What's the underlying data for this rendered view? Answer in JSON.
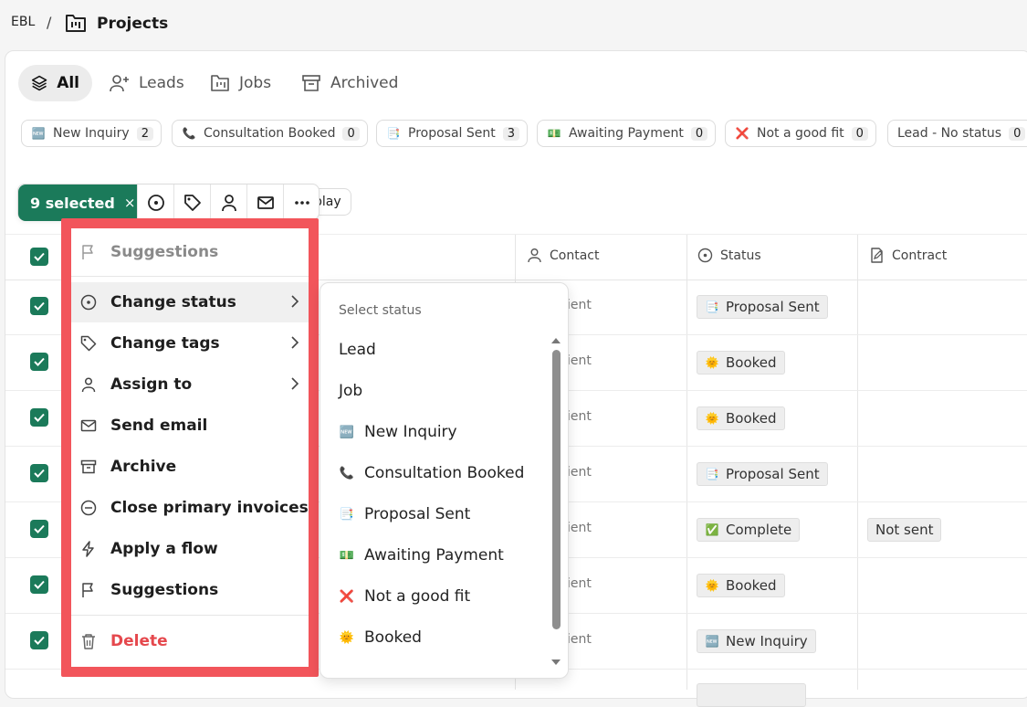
{
  "breadcrumb": {
    "root": "EBL",
    "separator": "/",
    "title": "Projects"
  },
  "tabs": [
    {
      "label": "All",
      "icon": "layers-icon",
      "active": true
    },
    {
      "label": "Leads",
      "icon": "add-user-icon"
    },
    {
      "label": "Jobs",
      "icon": "kanban-icon"
    },
    {
      "label": "Archived",
      "icon": "archive-icon"
    }
  ],
  "chips": [
    {
      "label": "New Inquiry",
      "count": "2",
      "emoji": "🆕"
    },
    {
      "label": "Consultation Booked",
      "count": "0",
      "emoji": "📞"
    },
    {
      "label": "Proposal Sent",
      "count": "3",
      "emoji": "📑"
    },
    {
      "label": "Awaiting Payment",
      "count": "0",
      "emoji": "💵"
    },
    {
      "label": "Not a good fit",
      "count": "0",
      "emoji": "❌"
    },
    {
      "label": "Lead - No status",
      "count": "0",
      "emoji": ""
    }
  ],
  "selection": {
    "label": "9 selected",
    "close": "×",
    "display_partial": "play"
  },
  "columns": {
    "contact": "Contact",
    "status": "Status",
    "contract": "Contract"
  },
  "rows": [
    {
      "contact": "ient",
      "status": "Proposal Sent",
      "status_emoji": "📑",
      "contract": ""
    },
    {
      "contact": "ient",
      "status": "Booked",
      "status_emoji": "🌞",
      "contract": ""
    },
    {
      "contact": "ient",
      "status": "Booked",
      "status_emoji": "🌞",
      "contract": ""
    },
    {
      "contact": "ient",
      "status": "Proposal Sent",
      "status_emoji": "📑",
      "contract": ""
    },
    {
      "contact": "ient",
      "status": "Complete",
      "status_emoji": "✅",
      "contract": "Not sent"
    },
    {
      "contact": "ient",
      "status": "Booked",
      "status_emoji": "🌞",
      "contract": ""
    },
    {
      "contact": "ient",
      "status": "New Inquiry",
      "status_emoji": "🆕",
      "contract": ""
    }
  ],
  "menu": {
    "suggestions_header": "Suggestions",
    "change_status": "Change status",
    "change_tags": "Change tags",
    "assign_to": "Assign to",
    "send_email": "Send email",
    "archive": "Archive",
    "close_invoices": "Close primary invoices",
    "apply_flow": "Apply a flow",
    "suggestions": "Suggestions",
    "delete": "Delete"
  },
  "status_submenu": {
    "heading": "Select status",
    "options": [
      {
        "label": "Lead",
        "emoji": ""
      },
      {
        "label": "Job",
        "emoji": ""
      },
      {
        "label": "New Inquiry",
        "emoji": "🆕"
      },
      {
        "label": "Consultation Booked",
        "emoji": "📞"
      },
      {
        "label": "Proposal Sent",
        "emoji": "📑"
      },
      {
        "label": "Awaiting Payment",
        "emoji": "💵"
      },
      {
        "label": "Not a good fit",
        "emoji": "❌"
      },
      {
        "label": "Booked",
        "emoji": "🌞"
      }
    ]
  },
  "colors": {
    "accent": "#1b7a5a",
    "highlight": "#f2555b",
    "danger": "#e5484d"
  }
}
